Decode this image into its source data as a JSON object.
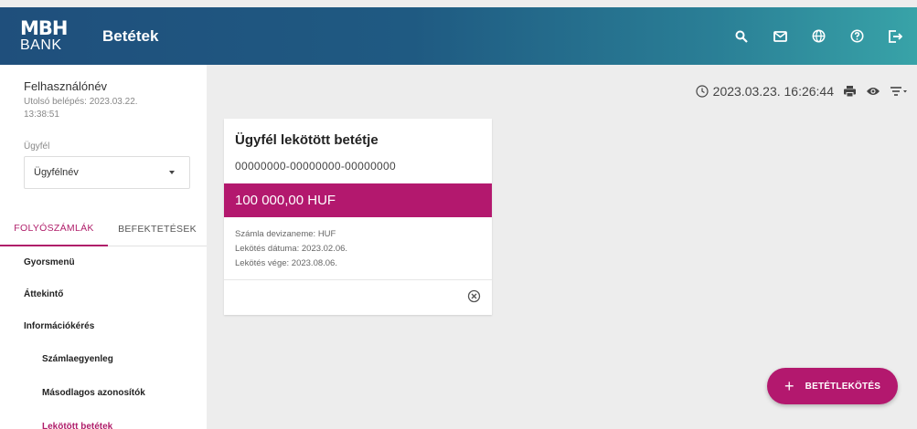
{
  "header": {
    "logo_line1": "MBH",
    "logo_line2": "BANK",
    "title": "Betétek",
    "icons": [
      "search-icon",
      "mail-icon",
      "globe-icon",
      "help-icon",
      "logout-icon"
    ]
  },
  "sidebar": {
    "username": "Felhasználónév",
    "last_login": "Utolsó belépés: 2023.03.22. 13:38:51",
    "client_label": "Ügyfél",
    "client_value": "Ügyfélnév",
    "tabs": [
      {
        "label": "FOLYÓSZÁMLÁK"
      },
      {
        "label": "BEFEKTETÉSEK"
      }
    ],
    "menu": [
      {
        "label": "Gyorsmenü"
      },
      {
        "label": "Áttekintő"
      },
      {
        "label": "Információkérés"
      },
      {
        "label": "Számlaegyenleg"
      },
      {
        "label": "Másodlagos azonosítók"
      },
      {
        "label": "Lekötött betétek"
      }
    ]
  },
  "toolbar": {
    "timestamp": "2023.03.23. 16:26:44",
    "icons": [
      "clock-icon",
      "print-icon",
      "eye-icon",
      "filter-icon"
    ]
  },
  "deposit_card": {
    "title": "Ügyfél lekötött betétje",
    "account_number": "00000000-00000000-00000000",
    "amount": "100 000,00 HUF",
    "currency_line": "Számla devizaneme: HUF",
    "start_date_line": "Lekötés dátuma: 2023.02.06.",
    "end_date_line": "Lekötés vége: 2023.08.06."
  },
  "fab": {
    "plus": "+",
    "label": "BETÉTLEKÖTÉS"
  },
  "colors": {
    "accent": "#b3186e",
    "header_start": "#1f4f7c",
    "header_end": "#38a3a8"
  }
}
